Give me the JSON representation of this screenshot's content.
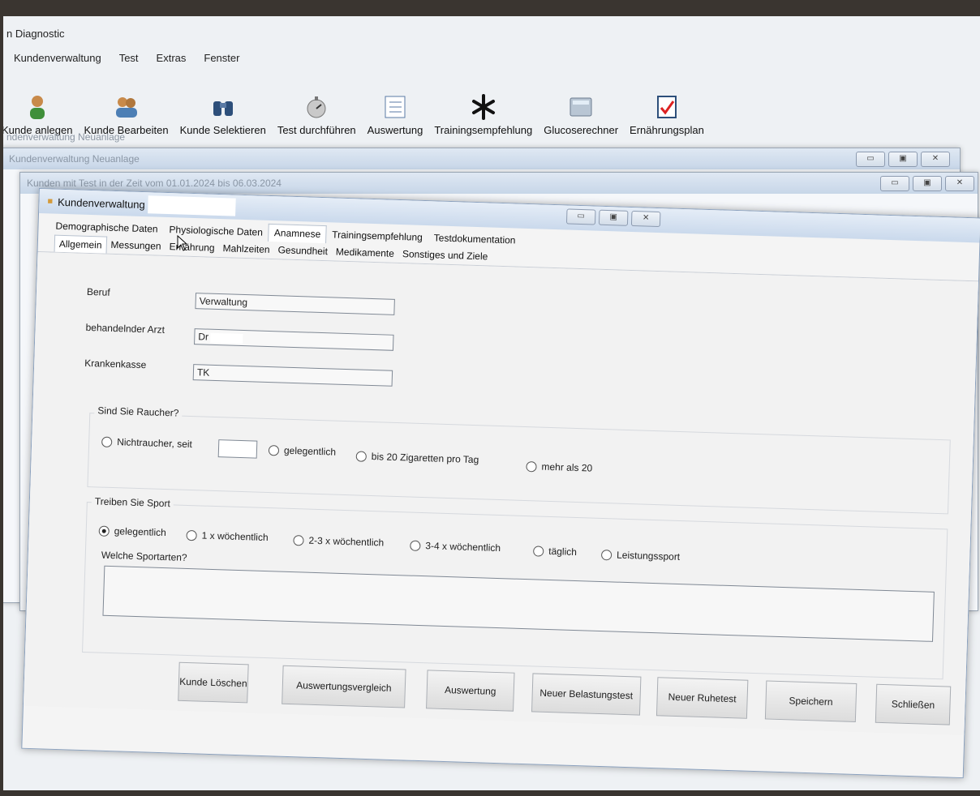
{
  "app": {
    "title": "n Diagnostic"
  },
  "menu": [
    "Kundenverwaltung",
    "Test",
    "Extras",
    "Fenster"
  ],
  "toolbar": [
    {
      "label": "Kunde anlegen",
      "icon": "person-add-icon"
    },
    {
      "label": "Kunde Bearbeiten",
      "icon": "people-edit-icon"
    },
    {
      "label": "Kunde Selektieren",
      "icon": "binoculars-icon"
    },
    {
      "label": "Test durchführen",
      "icon": "stopwatch-icon"
    },
    {
      "label": "Auswertung",
      "icon": "checklist-icon"
    },
    {
      "label": "Trainingsempfehlung",
      "icon": "asterisk-icon"
    },
    {
      "label": "Glucoserechner",
      "icon": "calculator-icon"
    },
    {
      "label": "Ernährungsplan",
      "icon": "checkmark-document-icon"
    }
  ],
  "background_windows": {
    "label1": "ndenverwaltung Neuanlage",
    "label2": "Kundenverwaltung Neuanlage",
    "label3": "Kunden mit Test in der Zeit vom 01.01.2024 bis 06.03.2024"
  },
  "main_window": {
    "title": "Kundenverwaltung",
    "tabs": [
      "Demographische Daten",
      "Physiologische Daten",
      "Anamnese",
      "Trainingsempfehlung",
      "Testdokumentation"
    ],
    "active_tab": "Anamnese",
    "subtabs": [
      "Allgemein",
      "Messungen",
      "Ernährung",
      "Mahlzeiten",
      "Gesundheit",
      "Medikamente",
      "Sonstiges und Ziele"
    ],
    "active_subtab": "Allgemein"
  },
  "form": {
    "beruf": {
      "label": "Beruf",
      "value": "Verwaltung"
    },
    "arzt": {
      "label": "behandelnder Arzt",
      "value": "Dr"
    },
    "kasse": {
      "label": "Krankenkasse",
      "value": "TK"
    },
    "raucher": {
      "label": "Sind Sie Raucher?",
      "options": [
        "Nichtraucher, seit",
        "gelegentlich",
        "bis 20 Zigaretten pro Tag",
        "mehr als 20"
      ],
      "selected": null
    },
    "sport": {
      "label": "Treiben Sie Sport",
      "options": [
        "gelegentlich",
        "1 x wöchentlich",
        "2-3 x wöchentlich",
        "3-4 x wöchentlich",
        "täglich",
        "Leistungssport"
      ],
      "selected": "gelegentlich"
    },
    "sportarten": {
      "label": "Welche Sportarten?",
      "value": ""
    }
  },
  "buttons": [
    "Kunde Löschen",
    "Auswertungsvergleich",
    "Auswertung",
    "Neuer Belastungstest",
    "Neuer Ruhetest",
    "Speichern",
    "Schließen"
  ]
}
